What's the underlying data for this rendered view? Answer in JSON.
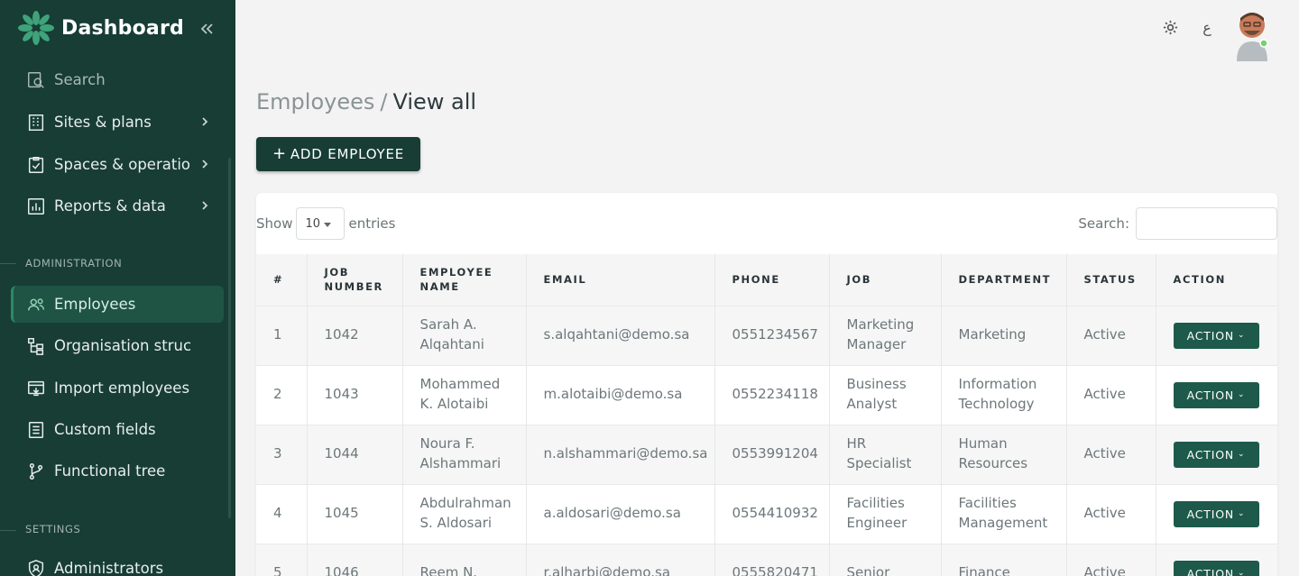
{
  "sidebar": {
    "brand": "Dashboard",
    "nav_top": [
      {
        "label": "Search",
        "icon": "search-icon"
      },
      {
        "label": "Sites & plans",
        "icon": "building-icon"
      },
      {
        "label": "Spaces & operations",
        "icon": "clipboard-check-icon"
      },
      {
        "label": "Reports & data",
        "icon": "chart-icon"
      }
    ],
    "admin_section": "ADMINISTRATION",
    "nav_admin": [
      {
        "label": "Employees",
        "icon": "users-icon"
      },
      {
        "label": "Organisation structure",
        "icon": "hierarchy-icon"
      },
      {
        "label": "Import employees",
        "icon": "import-icon"
      },
      {
        "label": "Custom fields",
        "icon": "list-icon"
      },
      {
        "label": "Functional tree",
        "icon": "branch-icon"
      }
    ],
    "settings_section": "SETTINGS",
    "nav_settings": [
      {
        "label": "Administrators",
        "icon": "admin-shield-icon"
      }
    ]
  },
  "topbar": {
    "language_glyph": "ع"
  },
  "breadcrumb": {
    "parent": "Employees",
    "separator": "/",
    "current": "View all"
  },
  "add_button": "ADD EMPLOYEE",
  "table_controls": {
    "show_label": "Show",
    "entries_value": "10",
    "entries_label": "entries",
    "search_label": "Search:"
  },
  "table": {
    "headers": [
      "#",
      "JOB NUMBER",
      "EMPLOYEE NAME",
      "EMAIL",
      "PHONE",
      "JOB",
      "DEPARTMENT",
      "STATUS",
      "ACTION"
    ],
    "rows": [
      {
        "num": "1",
        "job_number": "1042",
        "name": "Sarah A. Alqahtani",
        "email": "s.alqahtani@demo.sa",
        "phone": "0551234567",
        "job": "Marketing Manager",
        "department": "Marketing",
        "status": "Active",
        "action": "ACTION"
      },
      {
        "num": "2",
        "job_number": "1043",
        "name": "Mohammed K. Alotaibi",
        "email": "m.alotaibi@demo.sa",
        "phone": "0552234118",
        "job": "Business Analyst",
        "department": "Information Technology",
        "status": "Active",
        "action": "ACTION"
      },
      {
        "num": "3",
        "job_number": "1044",
        "name": "Noura F. Alshammari",
        "email": "n.alshammari@demo.sa",
        "phone": "0553991204",
        "job": "HR Specialist",
        "department": "Human Resources",
        "status": "Active",
        "action": "ACTION"
      },
      {
        "num": "4",
        "job_number": "1045",
        "name": "Abdulrahman S. Aldosari",
        "email": "a.aldosari@demo.sa",
        "phone": "0554410932",
        "job": "Facilities Engineer",
        "department": "Facilities Management",
        "status": "Active",
        "action": "ACTION"
      },
      {
        "num": "5",
        "job_number": "1046",
        "name": "Reem N.",
        "email": "r.alharbi@demo.sa",
        "phone": "0555820471",
        "job": "Senior",
        "department": "Finance",
        "status": "Active",
        "action": "ACTION"
      }
    ]
  }
}
